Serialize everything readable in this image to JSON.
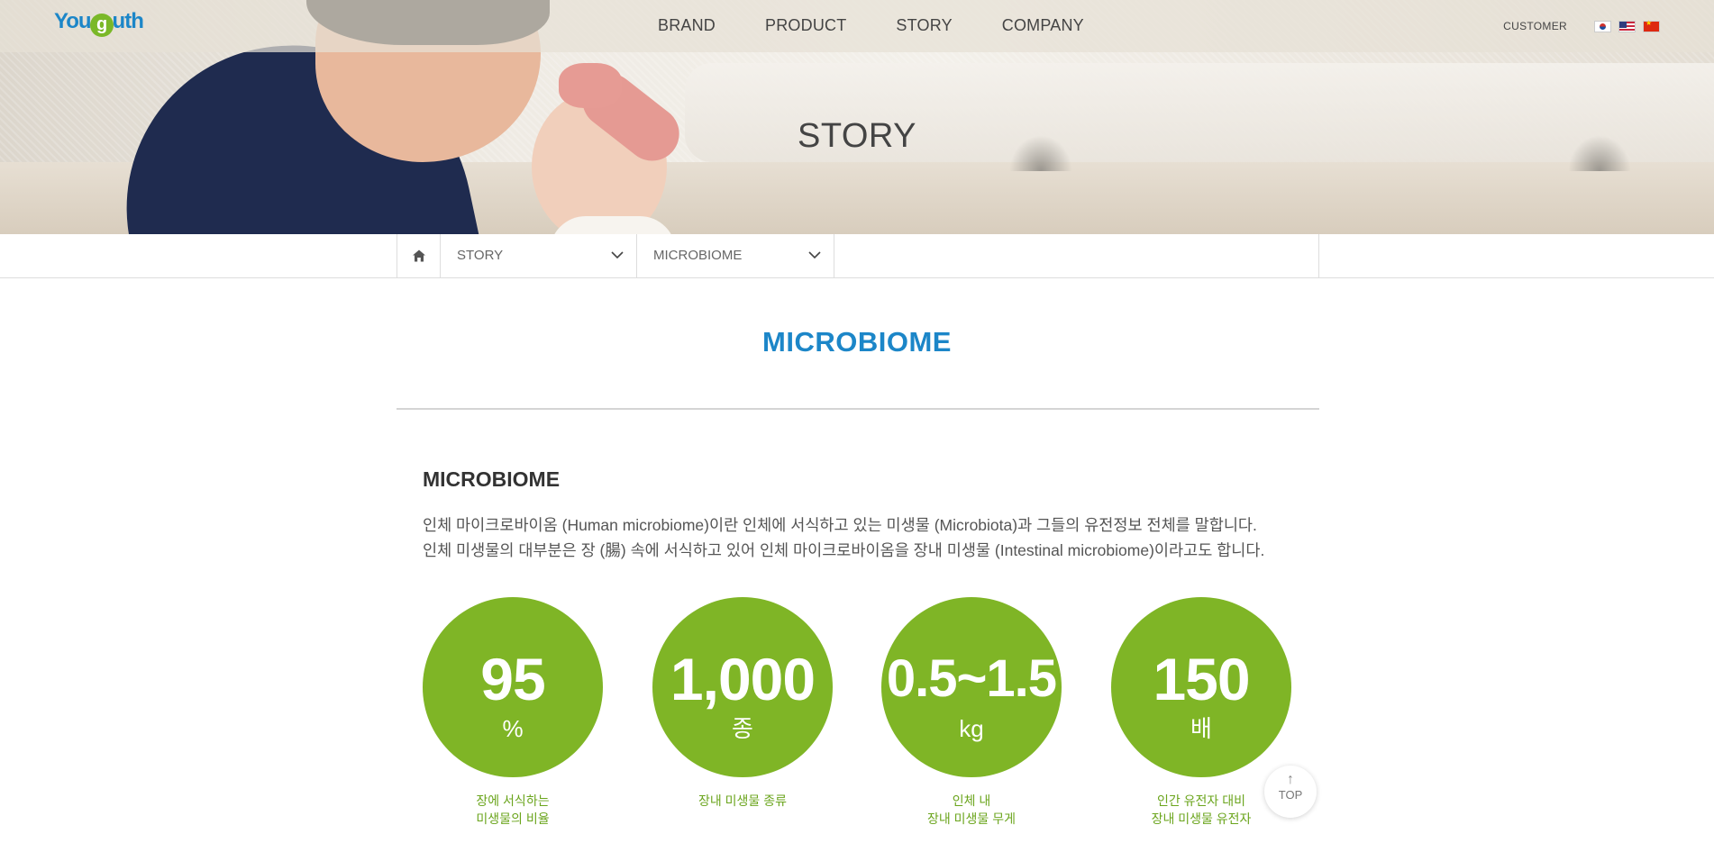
{
  "logo": {
    "text_pre": "You",
    "text_dot": "g",
    "text_post": "uth"
  },
  "nav": {
    "items": [
      "BRAND",
      "PRODUCT",
      "STORY",
      "COMPANY"
    ]
  },
  "utility": {
    "customer": "CUSTOMER",
    "languages": [
      "kr-flag-icon",
      "us-flag-icon",
      "cn-flag-icon"
    ]
  },
  "hero": {
    "title": "STORY"
  },
  "breadcrumb": {
    "home_icon": "home-icon",
    "level1": "STORY",
    "level2": "MICROBIOME"
  },
  "page": {
    "title": "MICROBIOME"
  },
  "section": {
    "title": "MICROBIOME",
    "desc_line1": "인체 마이크로바이옴 (Human microbiome)이란 인체에 서식하고 있는 미생물 (Microbiota)과 그들의 유전정보 전체를 말합니다.",
    "desc_line2": "인체 미생물의 대부분은 장 (腸) 속에 서식하고 있어 인체 마이크로바이옴을 장내 미생물 (Intestinal microbiome)이라고도 합니다."
  },
  "stats": [
    {
      "value": "95",
      "unit": "%",
      "cap1": "장에 서식하는",
      "cap2": "미생물의 비율"
    },
    {
      "value": "1,000",
      "unit": "종",
      "cap1": "장내 미생물 종류",
      "cap2": ""
    },
    {
      "value": "0.5~1.5",
      "unit": "kg",
      "cap1": "인체 내",
      "cap2": "장내 미생물 무게"
    },
    {
      "value": "150",
      "unit": "배",
      "cap1": "인간 유전자 대비",
      "cap2": "장내 미생물 유전자"
    }
  ],
  "top_button": {
    "label": "TOP"
  },
  "colors": {
    "brand_blue": "#1c86c8",
    "brand_green": "#7fb526"
  }
}
